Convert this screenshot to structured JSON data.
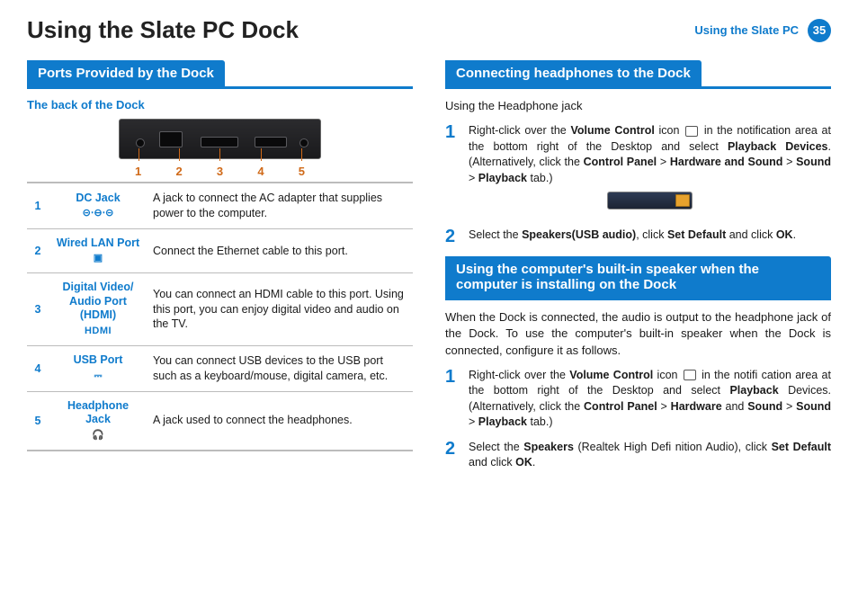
{
  "header": {
    "title": "Using the Slate PC Dock",
    "right_label": "Using the Slate PC",
    "page_num": "35"
  },
  "left": {
    "sec_title": "Ports Provided by the Dock",
    "sub": "The back of the Dock",
    "port_labels": [
      "1",
      "2",
      "3",
      "4",
      "5"
    ],
    "rows": [
      {
        "n": "1",
        "label": "DC Jack",
        "icon": "⊝⋅⊖⋅⊝",
        "desc": "A jack to connect the AC adapter that supplies power to the computer."
      },
      {
        "n": "2",
        "label": "Wired LAN Port",
        "icon": "▣",
        "desc": "Connect the Ethernet cable to this port."
      },
      {
        "n": "3",
        "label": "Digital Video/ Audio Port (HDMI)",
        "icon": "HDMI",
        "desc": "You can connect an HDMI cable to this port. Using this port, you can enjoy digital video and audio on the TV."
      },
      {
        "n": "4",
        "label": "USB Port",
        "icon": "⎓",
        "desc": "You can connect USB devices to the USB port such as a keyboard/mouse, digital camera, etc."
      },
      {
        "n": "5",
        "label": "Headphone Jack",
        "icon": "🎧",
        "desc": "A jack used to connect the headphones."
      }
    ]
  },
  "right": {
    "sec1_title": "Connecting headphones to the Dock",
    "intro1": "Using the Headphone jack",
    "steps_a": [
      {
        "n": "1",
        "prefix": "Right-click over the ",
        "b1": "Volume Control",
        "mid": " icon ",
        "aftericon": " in the notification area at the bottom right of the Desktop and select ",
        "b2": "Playback Devices",
        "alt": ". (Alternatively, click the ",
        "b3": "Control Panel",
        "gt1": " > ",
        "b4": "Hardware and Sound",
        "gt2": " > ",
        "b5": "Sound",
        "gt3": " > ",
        "b6": "Playback",
        "end": " tab.)"
      },
      {
        "n": "2",
        "prefix": "Select the ",
        "b1": "Speakers(USB audio)",
        "mid": ", click ",
        "b2": "Set Default",
        "mid2": " and click ",
        "b3": "OK",
        "end": "."
      }
    ],
    "sec2_title": "Using the computer's built-in speaker when the computer is installing on the Dock",
    "intro2": "When the Dock is connected, the audio is output to the headphone jack of the Dock. To use the computer's built-in speaker when the Dock is connected, configure it as follows.",
    "steps_b": [
      {
        "n": "1",
        "prefix": "Right-click over the ",
        "b1": "Volume Control",
        "mid": " icon ",
        "aftericon": "  in the notifi cation area at the bottom right of the Desktop and select ",
        "b2": "Playback",
        "afterb2": " Devices. (Alternatively, click the ",
        "b3": "Control Panel",
        "gt1": " > ",
        "b4": "Hardware",
        "mid2": " and ",
        "b5": "Sound",
        "gt2": " > ",
        "b6": "Sound",
        "gt3": " > ",
        "b7": "Playback",
        "end": " tab.)"
      },
      {
        "n": "2",
        "prefix": "Select the ",
        "b1": "Speakers",
        "mid": " (Realtek High Defi nition Audio), click ",
        "b2": "Set Default",
        "mid2": " and click ",
        "b3": "OK",
        "end": "."
      }
    ]
  }
}
